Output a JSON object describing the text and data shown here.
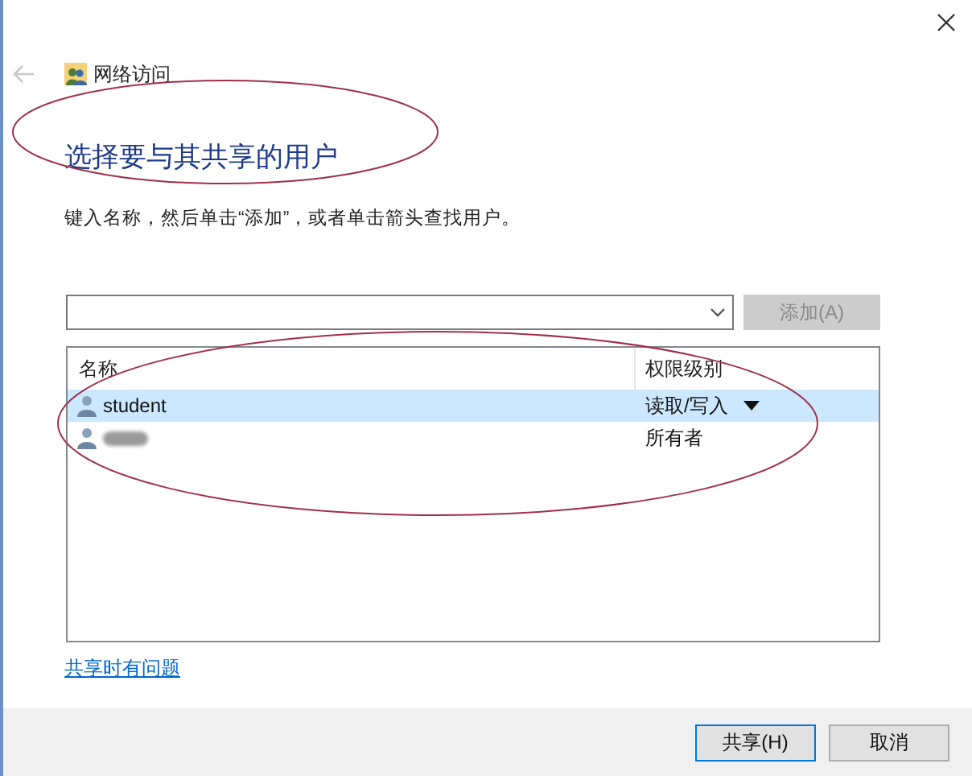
{
  "window": {
    "breadcrumb": "网络访问",
    "back_disabled": true
  },
  "heading": "选择要与其共享的用户",
  "instruction": "键入名称，然后单击“添加”，或者单击箭头查找用户。",
  "add_button": {
    "label": "添加(A)",
    "disabled": true
  },
  "table": {
    "columns": [
      "名称",
      "权限级别"
    ],
    "rows": [
      {
        "name": "student",
        "redacted": false,
        "permission": "读取/写入",
        "selected": true
      },
      {
        "redacted": true,
        "permission": "所有者",
        "selected": false
      }
    ]
  },
  "help_link": "共享时有问题",
  "buttons": [
    {
      "label": "共享(H)",
      "default": true
    },
    {
      "label": "取消",
      "default": false
    }
  ]
}
